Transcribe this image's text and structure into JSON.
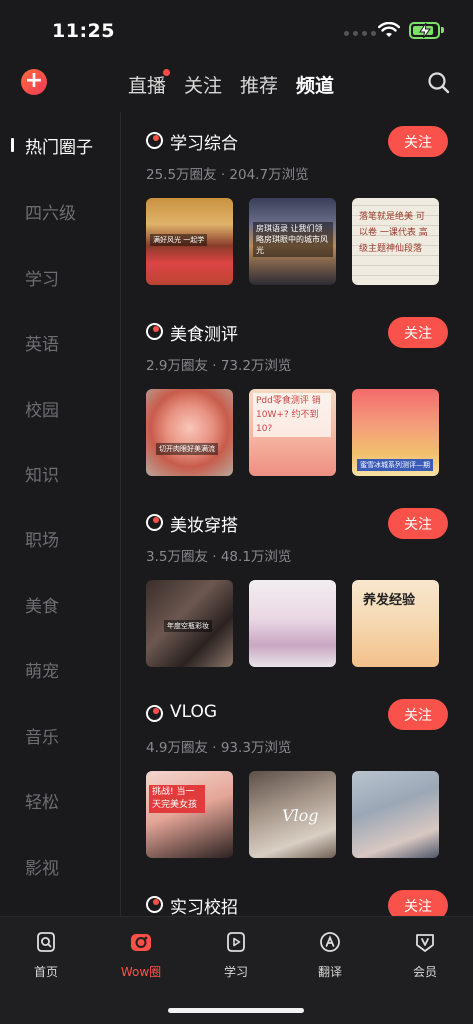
{
  "status": {
    "time": "11:25",
    "battery_level": 0.85
  },
  "top_nav": {
    "tabs": [
      {
        "label": "直播",
        "active": false,
        "badge": true
      },
      {
        "label": "关注",
        "active": false
      },
      {
        "label": "推荐",
        "active": false
      },
      {
        "label": "频道",
        "active": true
      }
    ]
  },
  "sidebar": {
    "items": [
      "热门圈子",
      "四六级",
      "学习",
      "英语",
      "校园",
      "知识",
      "职场",
      "美食",
      "萌宠",
      "音乐",
      "轻松",
      "影视"
    ],
    "active_index": 0
  },
  "sections": [
    {
      "title": "学习综合",
      "stats": "25.5万圈友 · 204.7万浏览",
      "follow_label": "关注",
      "thumb_texts": [
        "满好风光  一起学",
        "房琪语录  让我们领略房琪眼中的城市风光",
        "落笔就是绝美  可以卷  一课代表  高级主题神仙段落"
      ]
    },
    {
      "title": "美食测评",
      "stats": "2.9万圈友 · 73.2万浏览",
      "follow_label": "关注",
      "thumb_texts": [
        "切开肉眼好美满流",
        "Pdd零食测评  销10W+?  约不到10?",
        "蜜雪冰城系列测评—期"
      ]
    },
    {
      "title": "美妆穿搭",
      "stats": "3.5万圈友 · 48.1万浏览",
      "follow_label": "关注",
      "thumb_texts": [
        "年度空瓶彩妆",
        "",
        "养发经验"
      ]
    },
    {
      "title": "VLOG",
      "stats": "4.9万圈友 · 93.3万浏览",
      "follow_label": "关注",
      "thumb_texts": [
        "挑战!  当一天完美女孩",
        "Vlog",
        ""
      ]
    },
    {
      "title": "实习校招",
      "stats": "",
      "follow_label": "关注",
      "thumb_texts": []
    }
  ],
  "bottom_bar": {
    "items": [
      {
        "label": "首页",
        "icon": "home-search-icon",
        "active": false
      },
      {
        "label": "Wow圈",
        "icon": "wow-circle-icon",
        "active": true
      },
      {
        "label": "学习",
        "icon": "play-learn-icon",
        "active": false
      },
      {
        "label": "翻译",
        "icon": "translate-icon",
        "active": false
      },
      {
        "label": "会员",
        "icon": "vip-icon",
        "active": false
      }
    ]
  },
  "colors": {
    "accent": "#f8524a",
    "background": "#1a1a1c",
    "battery": "#7ce06b"
  }
}
